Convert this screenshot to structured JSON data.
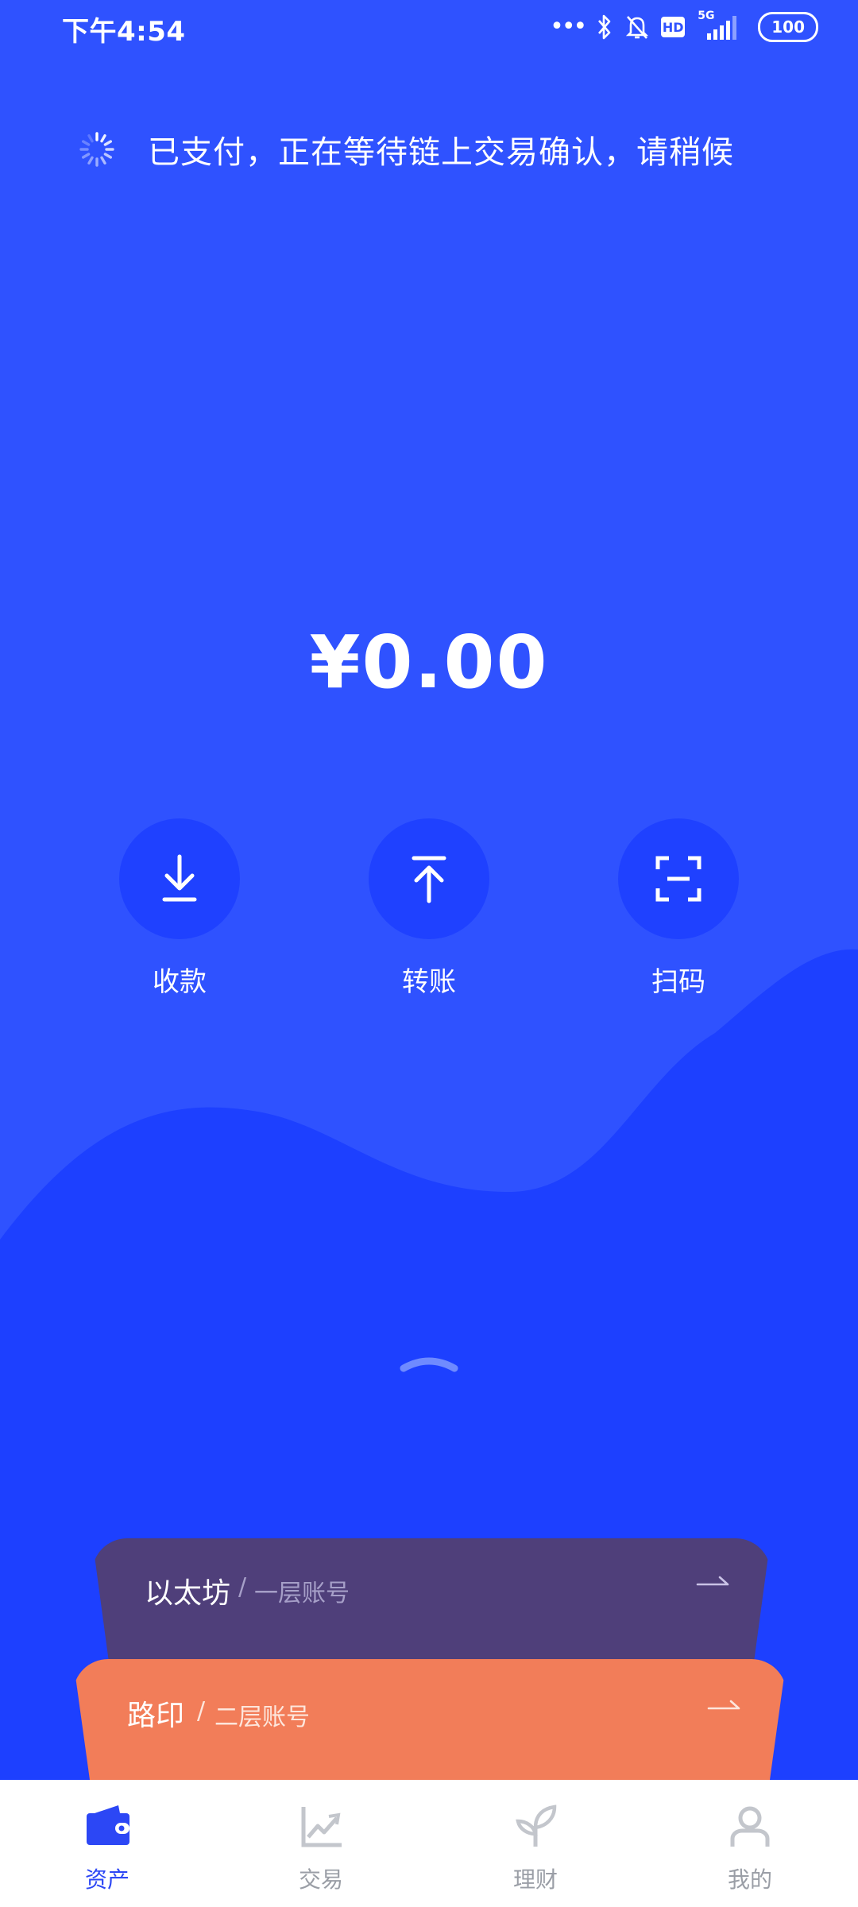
{
  "status_bar": {
    "time": "下午4:54",
    "icons": [
      "more-dots-icon",
      "bluetooth-icon",
      "bell-off-icon",
      "hd-icon",
      "cellular-5g-icon"
    ],
    "network": "5G",
    "hd": "HD",
    "battery": "100"
  },
  "pending": {
    "icon": "loading-spinner-icon",
    "message": "已支付，正在等待链上交易确认，请稍候"
  },
  "balance": "¥0.00",
  "actions": [
    {
      "label": "收款",
      "icon": "download-icon"
    },
    {
      "label": "转账",
      "icon": "upload-icon"
    },
    {
      "label": "扫码",
      "icon": "scan-icon"
    }
  ],
  "accounts": [
    {
      "name": "以太坊",
      "separator": "/",
      "subtitle": "一层账号",
      "color": "#4f3f7a"
    },
    {
      "name": "路印",
      "separator": "/",
      "subtitle": "二层账号",
      "color": "#f27d59"
    }
  ],
  "tabs": [
    {
      "label": "资产",
      "icon": "wallet-icon",
      "active": true
    },
    {
      "label": "交易",
      "icon": "chart-trend-icon",
      "active": false
    },
    {
      "label": "理财",
      "icon": "sprout-icon",
      "active": false
    },
    {
      "label": "我的",
      "icon": "user-icon",
      "active": false
    }
  ],
  "colors": {
    "background": "#2f52ff",
    "wave": "#1d40ff",
    "action_circle": "#1f41ff",
    "tab_active": "#2c47f5",
    "tab_inactive": "#9a9ea6"
  }
}
